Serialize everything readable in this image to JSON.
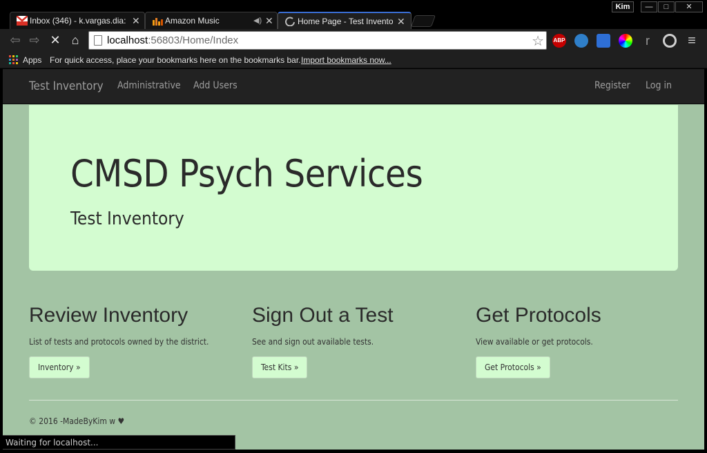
{
  "window": {
    "profile_name": "Kim",
    "minimize_glyph": "—",
    "maximize_glyph": "□",
    "close_glyph": "✕"
  },
  "tabs": [
    {
      "label": "Inbox (346) - k.vargas.dia:",
      "icon": "gmail-icon",
      "active": false
    },
    {
      "label": "Amazon Music",
      "icon": "amazon-music-icon",
      "audio_icon": "speaker-icon",
      "active": false
    },
    {
      "label": "Home Page - Test Invento",
      "icon": "loading-spinner-icon",
      "active": true
    }
  ],
  "tab_close_glyph": "✕",
  "address_bar": {
    "host": "localhost",
    "path": ":56803/Home/Index"
  },
  "extensions": [
    {
      "name": "adblock-plus-icon",
      "label": "ABP",
      "color": "#c40000"
    },
    {
      "name": "sync-icon",
      "label": "",
      "color": "#2f7fc9"
    },
    {
      "name": "folder-extension-icon",
      "label": "",
      "color": "#2e6fd6"
    },
    {
      "name": "color-wheel-icon",
      "label": "",
      "color": "#aa44aa"
    },
    {
      "name": "readability-icon",
      "label": "r",
      "color": "#1f1f1f"
    },
    {
      "name": "circle-extension-icon",
      "label": "",
      "color": "#1f1f1f"
    },
    {
      "name": "menu-icon",
      "label": "≡",
      "color": "#1f1f1f"
    }
  ],
  "bookmarks": {
    "apps_label": "Apps",
    "hint": "For quick access, place your bookmarks here on the bookmarks bar.",
    "import_link": "Import bookmarks now..."
  },
  "navbar": {
    "brand": "Test Inventory",
    "left_links": [
      "Administrative",
      "Add Users"
    ],
    "right_links": [
      "Register",
      "Log in"
    ]
  },
  "jumbotron": {
    "title": "CMSD Psych Services",
    "subtitle": "Test Inventory"
  },
  "columns": [
    {
      "heading": "Review Inventory",
      "text": "List of tests and protocols owned by the district.",
      "button": "Inventory »"
    },
    {
      "heading": "Sign Out a Test",
      "text": "See and sign out available tests.",
      "button": "Test Kits »"
    },
    {
      "heading": "Get Protocols",
      "text": "View available or get protocols.",
      "button": "Get Protocols »"
    }
  ],
  "footer": "© 2016 -MadeByKim w ♥",
  "status_text": "Waiting for localhost...",
  "colors": {
    "page_background": "#a3c4a4",
    "jumbotron_background": "#d3fcd0",
    "navbar_background": "#222222",
    "active_tab_underline": "#3b6fd6"
  }
}
